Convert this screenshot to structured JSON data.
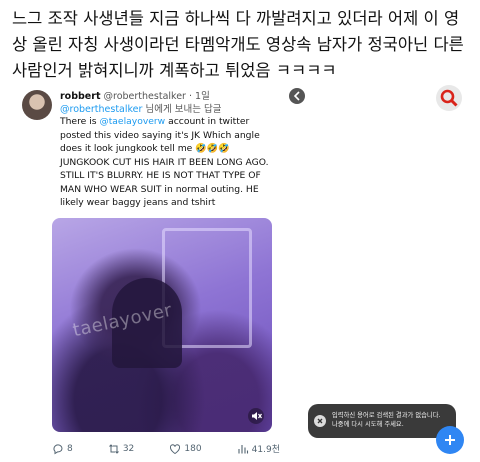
{
  "post": {
    "text": "느그 조작 사생년들 지금 하나씩 다 까발려지고 있더라 어제 이 영상 올린 자칭 사생이라던 타멤악개도 영상속 남자가 정국아닌 다른 사람인거 밝혀지니까 계폭하고 튀었음 ㅋㅋㅋㅋ"
  },
  "tweet": {
    "author_name": "robbert",
    "author_handle": "@roberthestalker",
    "separator": "·",
    "time": "1일",
    "reply_handle": "@roberthestalker",
    "reply_suffix": "님에게 보내는 답글",
    "body_prefix": "There is ",
    "body_mention": "@taelayoverw",
    "body_rest": " account in twitter posted this video saying it's JK Which angle does it look jungkook tell me 🤣🤣🤣",
    "body_caps": "JUNGKOOK CUT HIS HAIR IT BEEN LONG AGO. STILL IT'S BLURRY. HE IS NOT THAT TYPE OF MAN WHO WEAR SUIT in normal outing. HE likely wear baggy jeans and tshirt",
    "media_watermark": "taelayover",
    "actions": {
      "replies": "8",
      "retweets": "32",
      "likes": "180",
      "views": "41.9천"
    }
  },
  "search_panel": {
    "toast_line1": "입력하신 용어로 검색된 결과가 없습니다.",
    "toast_line2": "나중에 다시 시도해 주세요."
  },
  "colors": {
    "link": "#1d9bf0",
    "search_icon": "#d9231a",
    "fab": "#2f86f3",
    "media_tint": "#8e74d4"
  },
  "icons": [
    "reply-icon",
    "retweet-icon",
    "like-icon",
    "views-icon",
    "mute-icon",
    "back-arrow-icon",
    "search-icon",
    "close-icon",
    "plus-icon"
  ]
}
